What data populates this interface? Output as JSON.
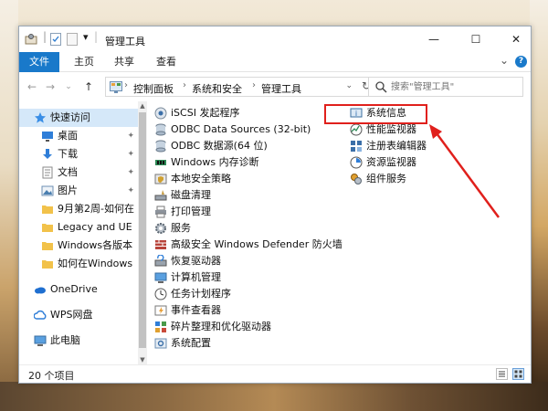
{
  "titlebar": {
    "title": "管理工具",
    "quick_access_dropdown": "▾",
    "minimize": "—",
    "maximize": "☐",
    "close": "✕"
  },
  "ribbon": {
    "tabs": [
      {
        "label": "文件"
      },
      {
        "label": "主页"
      },
      {
        "label": "共享"
      },
      {
        "label": "查看"
      }
    ],
    "collapse": "⌄",
    "help": "?"
  },
  "address_bar": {
    "crumbs": [
      "控制面板",
      "系统和安全",
      "管理工具"
    ],
    "separator": "›",
    "dropdown": "⌄",
    "refresh": "↻"
  },
  "search": {
    "placeholder": "搜索\"管理工具\""
  },
  "nav": {
    "back": "←",
    "forward": "→",
    "recent": "⌄",
    "up": "↑"
  },
  "sidebar": {
    "items": [
      {
        "label": "快速访问",
        "icon": "star-icon",
        "pinned": false
      },
      {
        "label": "桌面",
        "icon": "desktop-icon",
        "pinned": true
      },
      {
        "label": "下载",
        "icon": "download-icon",
        "pinned": true
      },
      {
        "label": "文档",
        "icon": "document-icon",
        "pinned": true
      },
      {
        "label": "图片",
        "icon": "picture-icon",
        "pinned": true
      },
      {
        "label": "9月第2周-如何在",
        "icon": "folder-icon",
        "pinned": false
      },
      {
        "label": "Legacy and UE",
        "icon": "folder-icon",
        "pinned": false
      },
      {
        "label": "Windows各版本",
        "icon": "folder-icon",
        "pinned": false
      },
      {
        "label": "如何在Windows",
        "icon": "folder-icon",
        "pinned": false
      },
      {
        "label": "OneDrive",
        "icon": "onedrive-icon",
        "pinned": false
      },
      {
        "label": "WPS网盘",
        "icon": "cloud-icon",
        "pinned": false
      },
      {
        "label": "此电脑",
        "icon": "computer-icon",
        "pinned": false
      }
    ],
    "pin_glyph": "📌"
  },
  "files": {
    "column1": [
      "iSCSI 发起程序",
      "ODBC Data Sources (32-bit)",
      "ODBC 数据源(64 位)",
      "Windows 内存诊断",
      "本地安全策略",
      "磁盘清理",
      "打印管理",
      "服务",
      "高级安全 Windows Defender 防火墙",
      "恢复驱动器",
      "计算机管理",
      "任务计划程序",
      "事件查看器",
      "碎片整理和优化驱动器",
      "系统配置"
    ],
    "column2": [
      "系统信息",
      "性能监视器",
      "注册表编辑器",
      "资源监视器",
      "组件服务"
    ]
  },
  "status": {
    "item_count": "20 个项目"
  },
  "colors": {
    "accent": "#1979ca",
    "highlight": "#e0201c",
    "selected": "#d5e8f9"
  }
}
